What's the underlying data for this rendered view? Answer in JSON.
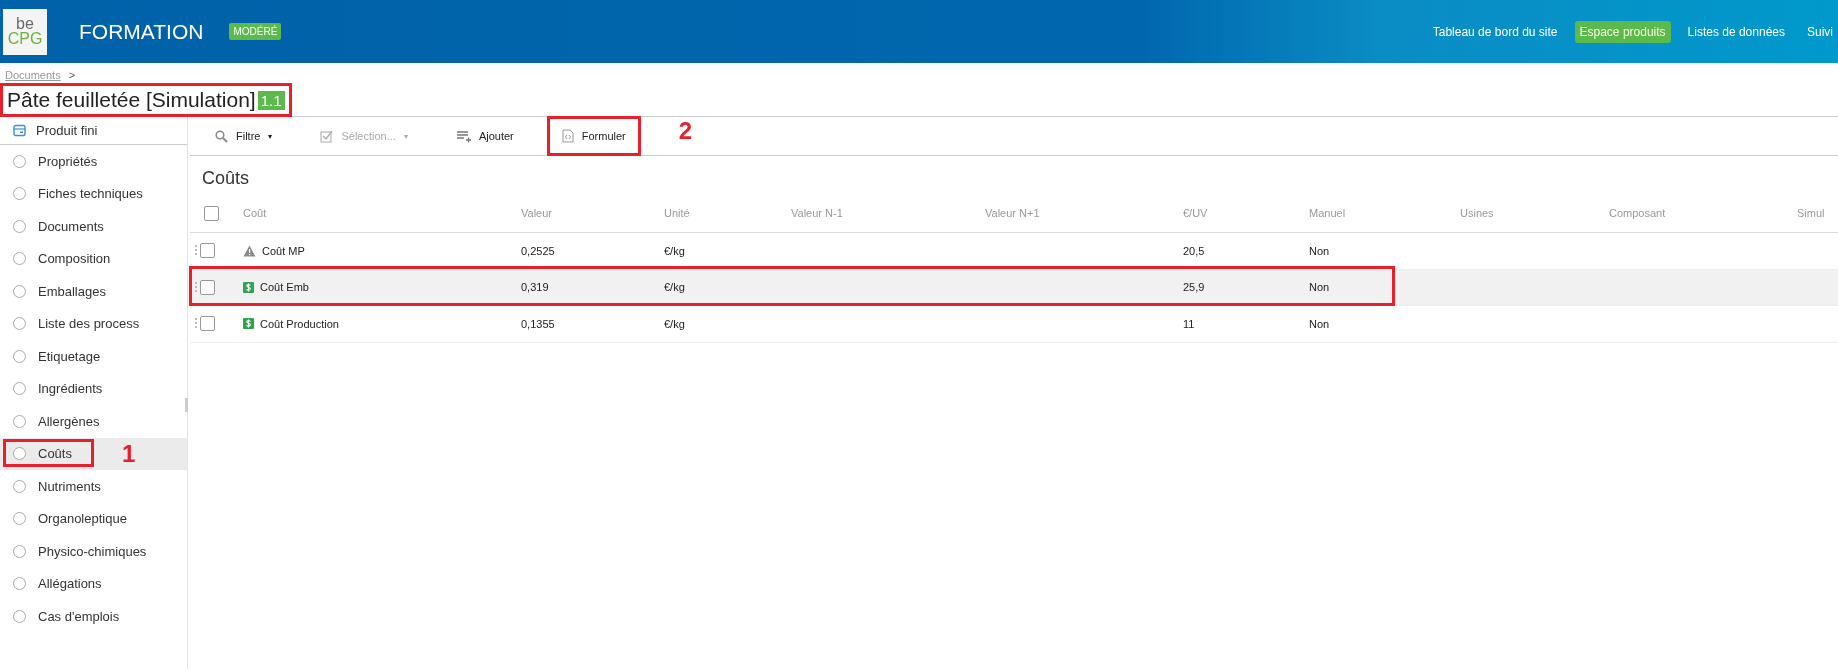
{
  "header": {
    "logo": {
      "top": "be",
      "bottom": "CPG"
    },
    "site_title": "FORMATION",
    "badge": "MODÉRÉ",
    "nav": [
      {
        "label": "Tableau de bord du site",
        "selected": false
      },
      {
        "label": "Espace produits",
        "selected": true
      },
      {
        "label": "Listes de données",
        "selected": false
      },
      {
        "label": "Suivi",
        "selected": false
      }
    ]
  },
  "breadcrumb": {
    "label": "Documents",
    "separator": ">"
  },
  "page_title": {
    "text": "Pâte feuilletée [Simulation]",
    "version": "1.1",
    "highlighted": true
  },
  "sidebar": {
    "header": "Produit fini",
    "items": [
      {
        "label": "Propriétés",
        "selected": false,
        "highlighted": false
      },
      {
        "label": "Fiches techniques",
        "selected": false,
        "highlighted": false
      },
      {
        "label": "Documents",
        "selected": false,
        "highlighted": false
      },
      {
        "label": "Composition",
        "selected": false,
        "highlighted": false
      },
      {
        "label": "Emballages",
        "selected": false,
        "highlighted": false
      },
      {
        "label": "Liste des process",
        "selected": false,
        "highlighted": false
      },
      {
        "label": "Etiquetage",
        "selected": false,
        "highlighted": false
      },
      {
        "label": "Ingrédients",
        "selected": false,
        "highlighted": false
      },
      {
        "label": "Allergènes",
        "selected": false,
        "highlighted": false
      },
      {
        "label": "Coûts",
        "selected": true,
        "highlighted": true,
        "annotation": "1"
      },
      {
        "label": "Nutriments",
        "selected": false,
        "highlighted": false
      },
      {
        "label": "Organoleptique",
        "selected": false,
        "highlighted": false
      },
      {
        "label": "Physico-chimiques",
        "selected": false,
        "highlighted": false
      },
      {
        "label": "Allégations",
        "selected": false,
        "highlighted": false
      },
      {
        "label": "Cas d'emplois",
        "selected": false,
        "highlighted": false
      }
    ]
  },
  "toolbar": [
    {
      "kind": "filter",
      "label": "Filtre",
      "disabled": false,
      "caret": "▾",
      "highlighted": false
    },
    {
      "kind": "select",
      "label": "Sélection...",
      "disabled": true,
      "caret": "▾",
      "highlighted": false
    },
    {
      "kind": "add",
      "label": "Ajouter",
      "disabled": false,
      "highlighted": false
    },
    {
      "kind": "formulate",
      "label": "Formuler",
      "disabled": false,
      "highlighted": true,
      "annotation": "2"
    }
  ],
  "table": {
    "title": "Coûts",
    "select_all": {
      "checked": false
    },
    "columns": [
      "Coût",
      "Valeur",
      "Unité",
      "Valeur N-1",
      "Valeur N+1",
      "€/UV",
      "Manuel",
      "Usines",
      "Composant",
      "Simul"
    ],
    "rows": [
      {
        "kind": "warning",
        "checked": false,
        "selected": false,
        "highlighted": false,
        "cells": [
          "Coût MP",
          "0,2525",
          "€/kg",
          "",
          "",
          "20,5",
          "Non",
          "",
          "",
          ""
        ]
      },
      {
        "kind": "cost",
        "checked": false,
        "selected": true,
        "highlighted": true,
        "cells": [
          "Coût Emb",
          "0,319",
          "€/kg",
          "",
          "",
          "25,9",
          "Non",
          "",
          "",
          ""
        ]
      },
      {
        "kind": "cost",
        "checked": false,
        "selected": false,
        "highlighted": false,
        "cells": [
          "Coût Production",
          "0,1355",
          "€/kg",
          "",
          "",
          "11",
          "Non",
          "",
          "",
          ""
        ]
      }
    ]
  }
}
